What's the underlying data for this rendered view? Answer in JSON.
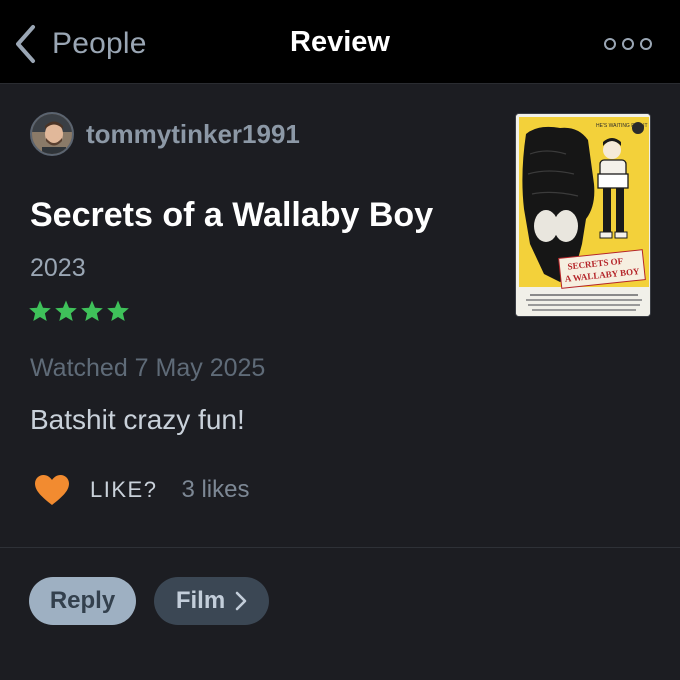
{
  "nav": {
    "back_label": "People",
    "title": "Review"
  },
  "review": {
    "username": "tommytinker1991",
    "film_title": "Secrets of a Wallaby Boy",
    "year": "2023",
    "rating_stars": 4,
    "watched": "Watched 7 May 2025",
    "text": "Batshit crazy fun!",
    "like_label": "LIKE?",
    "likes_count": "3 likes"
  },
  "poster": {
    "tagline": "HE'S WAITING FOR IT",
    "title_line1": "SECRETS OF",
    "title_line2": "A WALLABY BOY"
  },
  "actions": {
    "reply_label": "Reply",
    "film_label": "Film"
  },
  "colors": {
    "background": "#1c1d22",
    "star": "#3fc15a",
    "heart": "#f28b30",
    "reply_button": "#9eb0c2",
    "film_button": "#3b4754"
  },
  "icons": [
    "chevron-left-icon",
    "more-icon",
    "star-icon",
    "heart-icon",
    "chevron-right-icon"
  ]
}
